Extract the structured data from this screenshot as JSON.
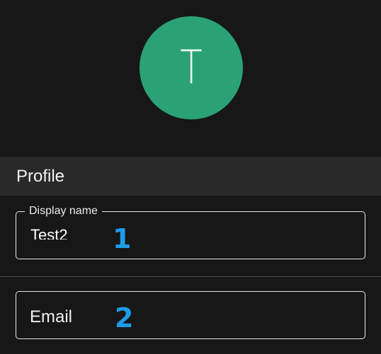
{
  "avatar": {
    "letter": "T",
    "color": "#2aa276"
  },
  "profile_section": {
    "title": "Profile"
  },
  "display_name_field": {
    "label": "Display name",
    "value": "Test2"
  },
  "email_field": {
    "placeholder": "Email",
    "value": ""
  },
  "annotations": {
    "marker_1": "1",
    "marker_2": "2",
    "color": "#1e9be8"
  }
}
